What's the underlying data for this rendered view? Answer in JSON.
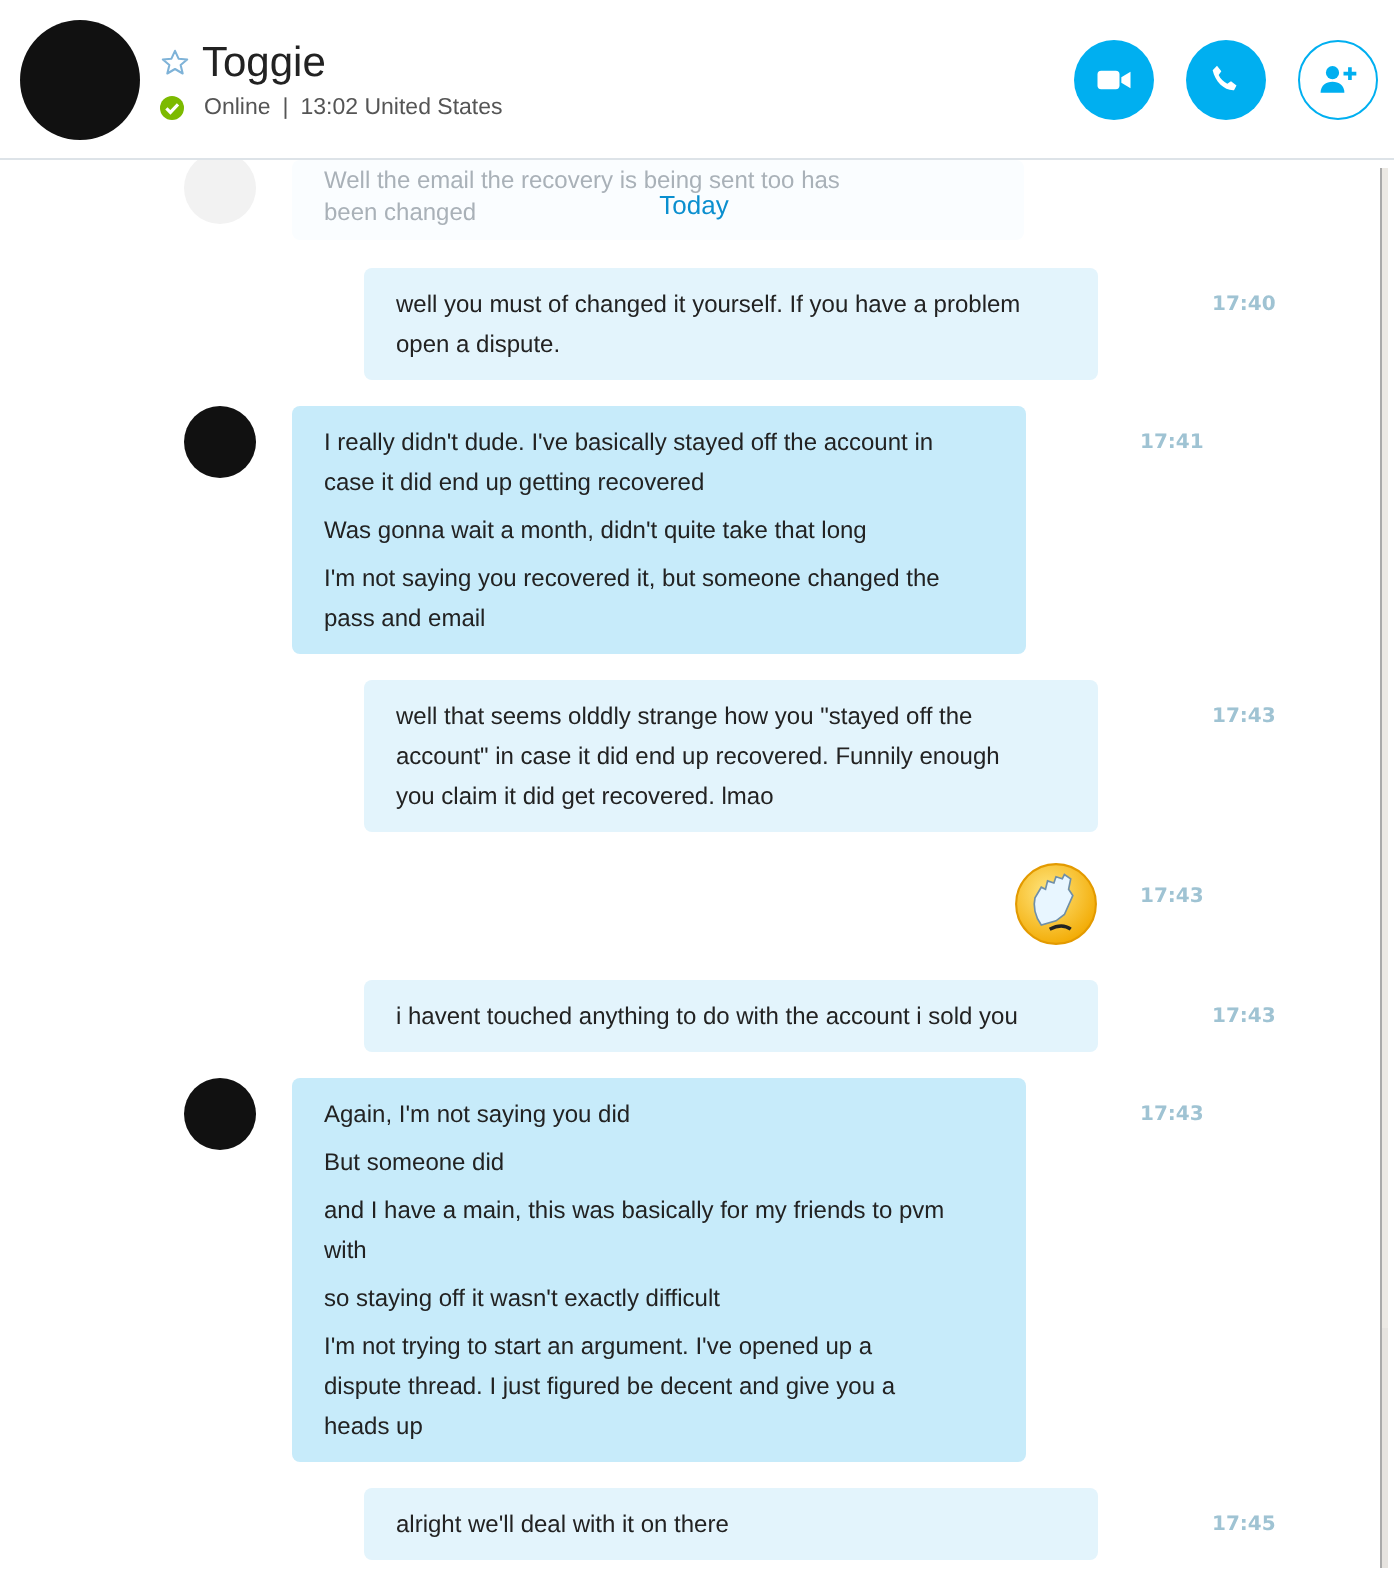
{
  "contact": {
    "name": "Toggie",
    "starred": false,
    "status": "Online",
    "separator": "|",
    "status_detail": "13:02 United States"
  },
  "day_label": "Today",
  "faded_message": [
    "Well the email the recovery is being sent too has",
    "been changed"
  ],
  "messages": [
    {
      "kind": "out",
      "lines": [
        "well you must of changed it yourself. If you have a problem open a dispute."
      ],
      "time": "17:40"
    },
    {
      "kind": "in",
      "lines": [
        "I really didn't dude. I've basically stayed off the account in case it did end up getting recovered",
        "Was gonna wait a month, didn't quite take that long",
        "I'm not saying you recovered it, but someone changed the pass and email"
      ],
      "time": "17:41"
    },
    {
      "kind": "out",
      "lines": [
        "well that seems olddly strange how you \"stayed off the account\" in case it did end up recovered. Funnily enough you claim it did get recovered. lmao"
      ],
      "time": "17:43"
    },
    {
      "kind": "emoji",
      "time": "17:43"
    },
    {
      "kind": "out",
      "lines": [
        "i havent touched anything to do with the account i sold you"
      ],
      "time": "17:43"
    },
    {
      "kind": "in",
      "lines": [
        "Again, I'm not saying you did",
        "But someone did",
        "and I have a main, this was basically for my friends to pvm with",
        "so staying off it wasn't exactly difficult",
        "I'm not trying to start an argument. I've opened up a dispute thread. I just figured be decent and give you a heads up"
      ],
      "time": "17:43"
    },
    {
      "kind": "out",
      "lines": [
        "alright we'll deal with it on there"
      ],
      "time": "17:45"
    }
  ]
}
